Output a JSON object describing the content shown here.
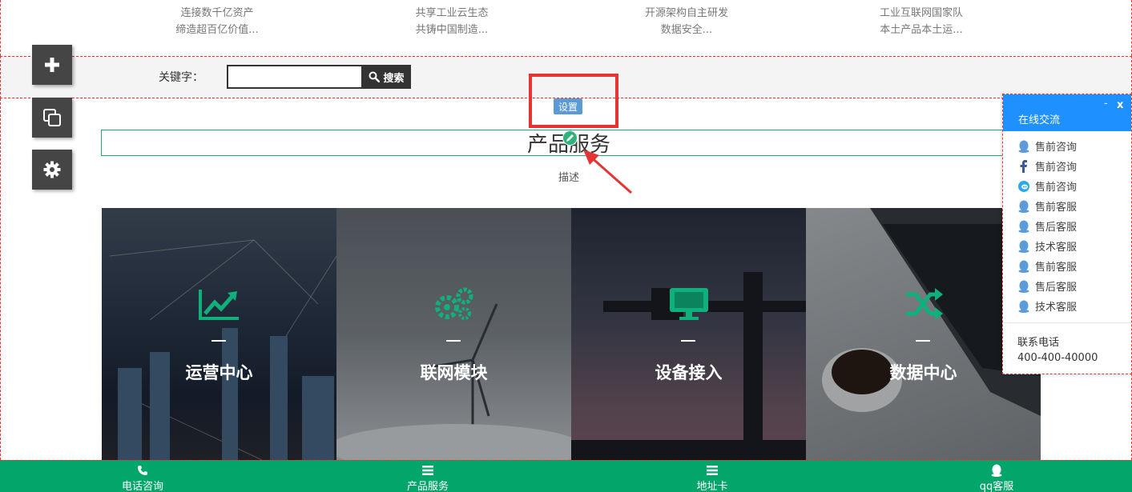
{
  "features": [
    {
      "line1": "连接数千亿资产",
      "line2": "缔造超百亿价值..."
    },
    {
      "line1": "共享工业云生态",
      "line2": "共铸中国制造..."
    },
    {
      "line1": "开源架构自主研发",
      "line2": "数据安全..."
    },
    {
      "line1": "工业互联网国家队",
      "line2": "本土产品本土运..."
    }
  ],
  "search": {
    "label": "关键字：",
    "value": "",
    "button_label": "搜索"
  },
  "toolbar": {
    "icons": [
      "plus-icon",
      "copy-icon",
      "gear-icon"
    ]
  },
  "section": {
    "settings_label": "设置",
    "title": "产品服务",
    "description": "描述"
  },
  "cards": [
    {
      "label": "运营中心",
      "icon": "chart-line-icon"
    },
    {
      "label": "联网模块",
      "icon": "gears-icon"
    },
    {
      "label": "设备接入",
      "icon": "monitor-icon"
    },
    {
      "label": "数据中心",
      "icon": "shuffle-icon"
    }
  ],
  "chat": {
    "title": "在线交流",
    "minimize": "-",
    "close": "x",
    "items": [
      {
        "label": "售前咨询",
        "icon": "qq-icon"
      },
      {
        "label": "售前咨询",
        "icon": "facebook-icon"
      },
      {
        "label": "售前咨询",
        "icon": "wangwang-icon"
      },
      {
        "label": "售前客服",
        "icon": "qq-icon"
      },
      {
        "label": "售后客服",
        "icon": "qq-icon"
      },
      {
        "label": "技术客服",
        "icon": "qq-icon"
      },
      {
        "label": "售前客服",
        "icon": "qq-icon"
      },
      {
        "label": "售后客服",
        "icon": "qq-icon"
      },
      {
        "label": "技术客服",
        "icon": "qq-icon"
      }
    ],
    "phone_label": "联系电话",
    "phone": "400-400-40000"
  },
  "bottom_bar": [
    {
      "label": "电话咨询",
      "icon": "phone-icon"
    },
    {
      "label": "产品服务",
      "icon": "menu-icon"
    },
    {
      "label": "地址卡",
      "icon": "menu-icon"
    },
    {
      "label": "qq客服",
      "icon": "qq-icon"
    }
  ],
  "colors": {
    "accent_green": "#03a66a",
    "chat_blue": "#1e90ff",
    "highlight_red": "#e63333"
  }
}
